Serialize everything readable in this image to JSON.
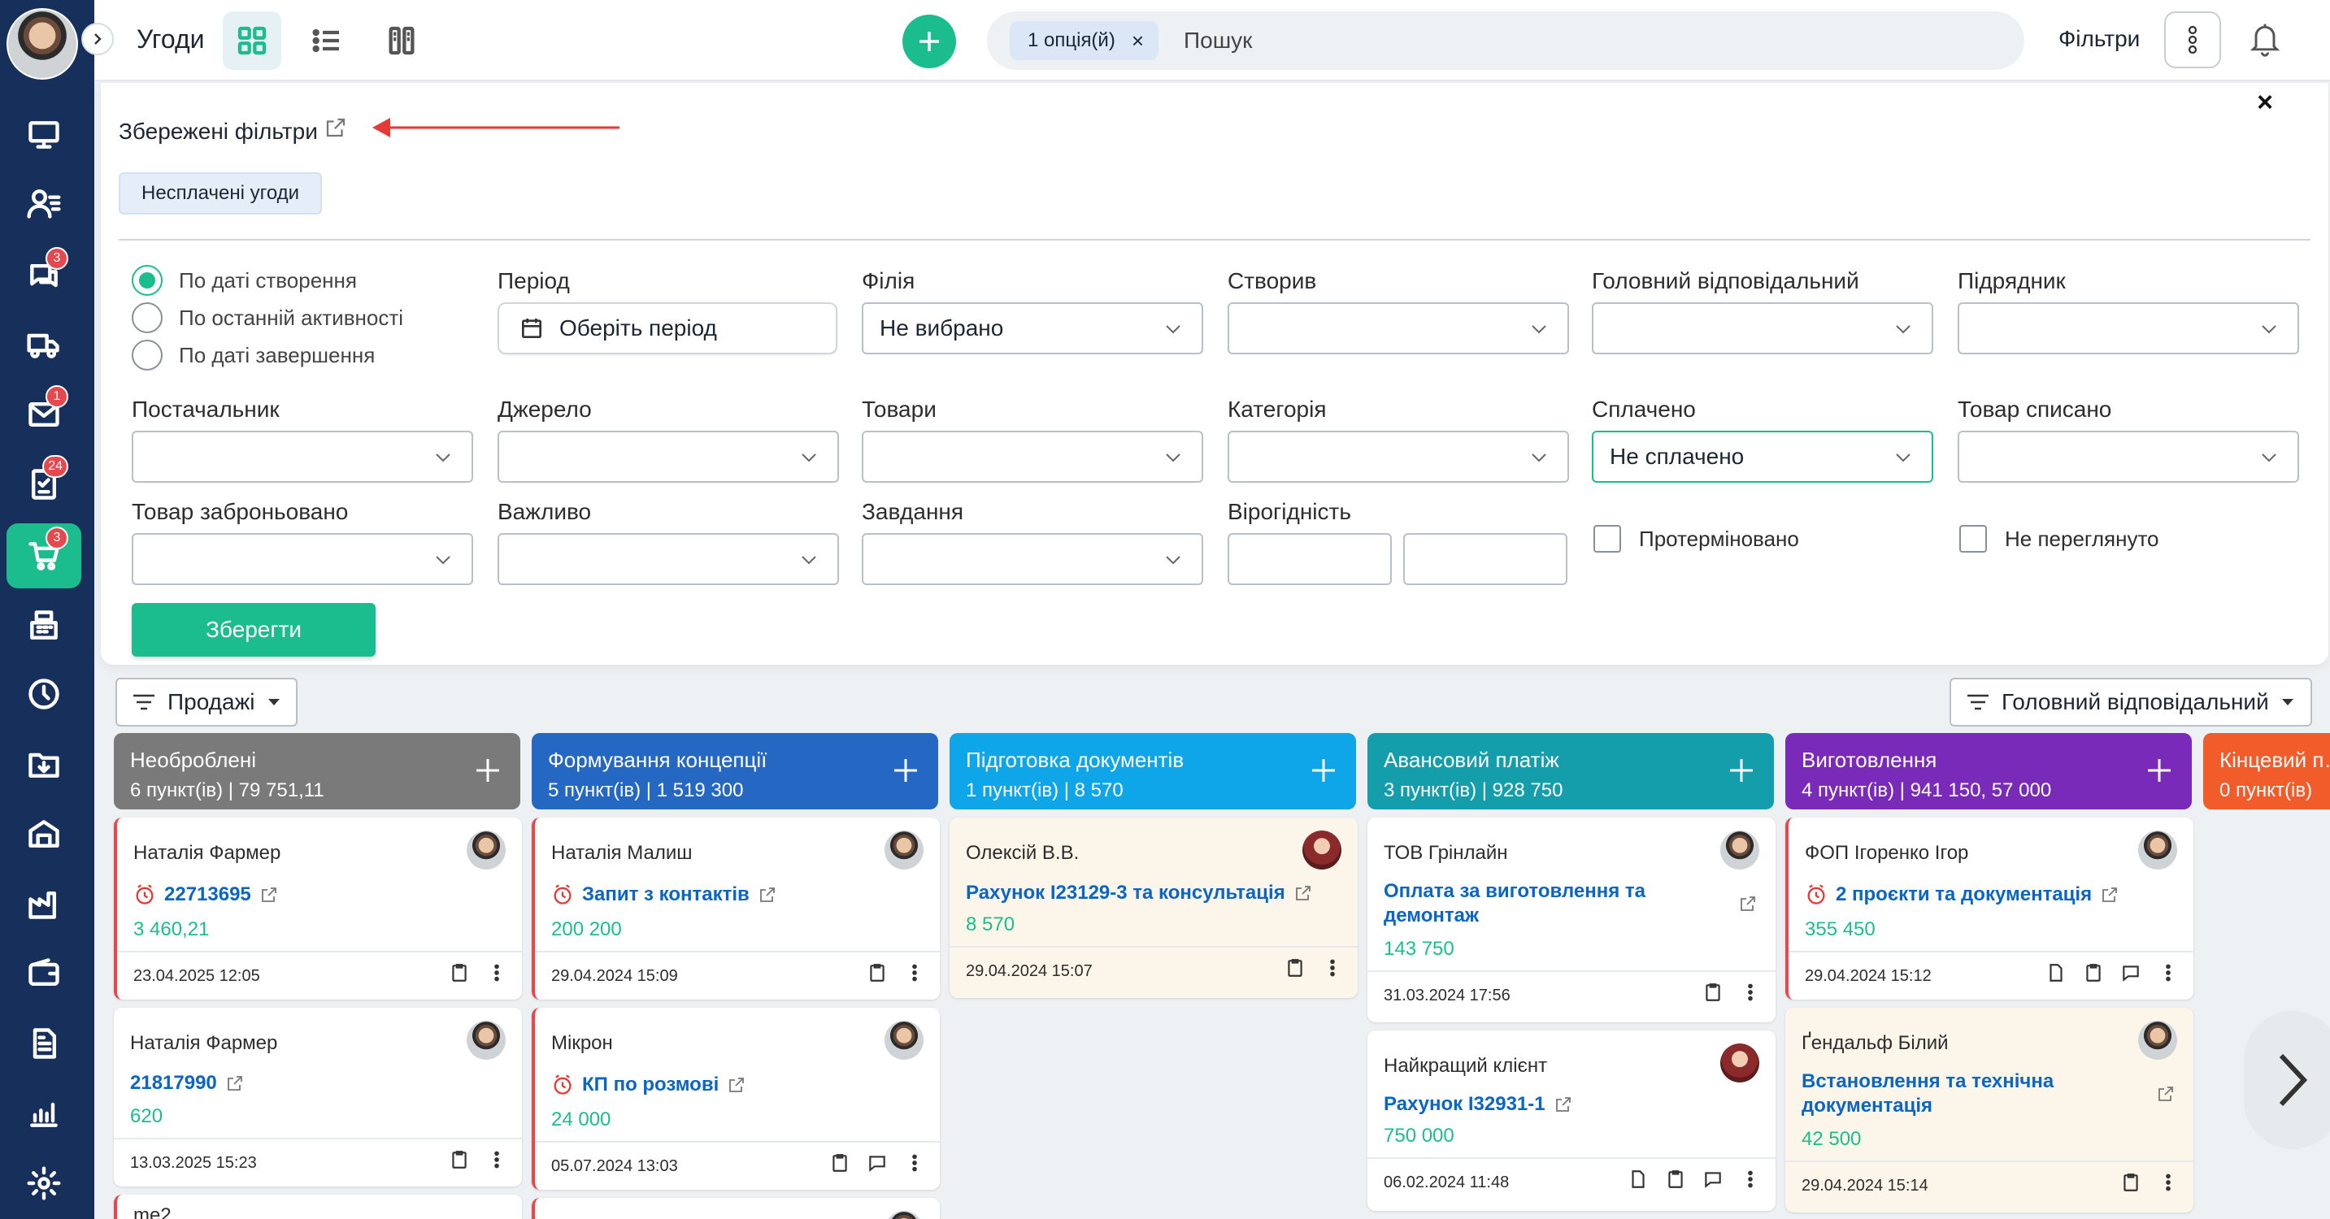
{
  "header": {
    "title": "Угоди",
    "search_chip": "1 опція(й)",
    "search_chip_remove": "×",
    "search_placeholder": "Пошук",
    "filters_label": "Фільтри"
  },
  "sidebar": {
    "badges": {
      "chat": "3",
      "mail": "1",
      "tasks": "24",
      "deals": "3"
    },
    "active_item": "deals",
    "active_color": "#1bbd8f",
    "background": "#17305b"
  },
  "filter_panel": {
    "saved_title": "Збережені фільтри",
    "saved_chip": "Несплачені угоди",
    "close_label": "×",
    "date_modes": [
      {
        "label": "По даті створення",
        "selected": true
      },
      {
        "label": "По останній активності",
        "selected": false
      },
      {
        "label": "По даті завершення",
        "selected": false
      }
    ],
    "period": {
      "label": "Період",
      "button": "Оберіть період"
    },
    "fields": {
      "branch": {
        "label": "Філія",
        "value": "Не вибрано"
      },
      "created_by": {
        "label": "Створив",
        "value": ""
      },
      "main_responsible": {
        "label": "Головний відповідальний",
        "value": ""
      },
      "contractor": {
        "label": "Підрядник",
        "value": ""
      },
      "supplier": {
        "label": "Постачальник",
        "value": ""
      },
      "source": {
        "label": "Джерело",
        "value": ""
      },
      "products": {
        "label": "Товари",
        "value": ""
      },
      "category": {
        "label": "Категорія",
        "value": ""
      },
      "paid": {
        "label": "Сплачено",
        "value": "Не сплачено"
      },
      "written_off": {
        "label": "Товар списано",
        "value": ""
      },
      "reserved": {
        "label": "Товар заброньовано",
        "value": ""
      },
      "important": {
        "label": "Важливо",
        "value": ""
      },
      "tasks": {
        "label": "Завдання",
        "value": ""
      },
      "probability": {
        "label": "Вірогідність"
      }
    },
    "checkboxes": {
      "overdue": "Протерміновано",
      "unseen": "Не переглянуто"
    },
    "save_button": "Зберегти"
  },
  "board": {
    "pipeline": "Продажі",
    "group_by": "Головний відповідальний",
    "columns": [
      {
        "name": "Необроблені",
        "meta": "6 пункт(ів)  | 79 751,11",
        "color": "#7a7a7a",
        "cards": [
          {
            "client": "Наталія Фармер",
            "title": "22713695",
            "amount": "3 460,21",
            "date": "23.04.2025 12:05",
            "overdue": true
          },
          {
            "client": "Наталія Фармер",
            "title": "21817990",
            "amount": "620",
            "date": "13.03.2025 15:23",
            "overdue": false
          },
          {
            "client": "me2"
          }
        ]
      },
      {
        "name": "Формування концепції",
        "meta": "5 пункт(ів)  | 1 519 300",
        "color": "#2568c3",
        "cards": [
          {
            "client": "Наталія Малиш",
            "title": "Запит з контактів",
            "amount": "200 200",
            "date": "29.04.2024 15:09",
            "overdue": true
          },
          {
            "client": "Мікрон",
            "title": "КП по розмові",
            "amount": "24 000",
            "date": "05.07.2024 13:03",
            "overdue": true
          }
        ]
      },
      {
        "name": "Підготовка документів",
        "meta": "1 пункт(ів)  | 8 570",
        "color": "#0ea5e9",
        "cards": [
          {
            "client": "Олексій В.В.",
            "title": "Рахунок I23129-3 та консультація",
            "amount": "8 570",
            "date": "29.04.2024 15:07"
          }
        ]
      },
      {
        "name": "Авансовий платіж",
        "meta": "3 пункт(ів)  | 928 750",
        "color": "#149eab",
        "cards": [
          {
            "client": "ТОВ Грінлайн",
            "title": "Оплата за виготовлення та демонтаж",
            "amount": "143 750",
            "date": "31.03.2024 17:56"
          },
          {
            "client": "Найкращий клієнт",
            "title": "Рахунок I32931-1",
            "amount": "750 000",
            "date": "06.02.2024 11:48"
          }
        ]
      },
      {
        "name": "Виготовлення",
        "meta": "4 пункт(ів)  | 941 150, 57 000",
        "color": "#7a2ab8",
        "cards": [
          {
            "client": "ФОП Ігоренко Ігор",
            "title": "2 проєкти та документація",
            "amount": "355 450",
            "date": "29.04.2024 15:12",
            "overdue": true
          },
          {
            "client": "Ґендальф Білий",
            "title": "Встановлення та технічна документація",
            "amount": "42 500",
            "date": "29.04.2024 15:14"
          }
        ]
      },
      {
        "name": "Кінцевий п…",
        "meta": "0 пункт(ів)",
        "color": "#f25c2a"
      }
    ]
  }
}
